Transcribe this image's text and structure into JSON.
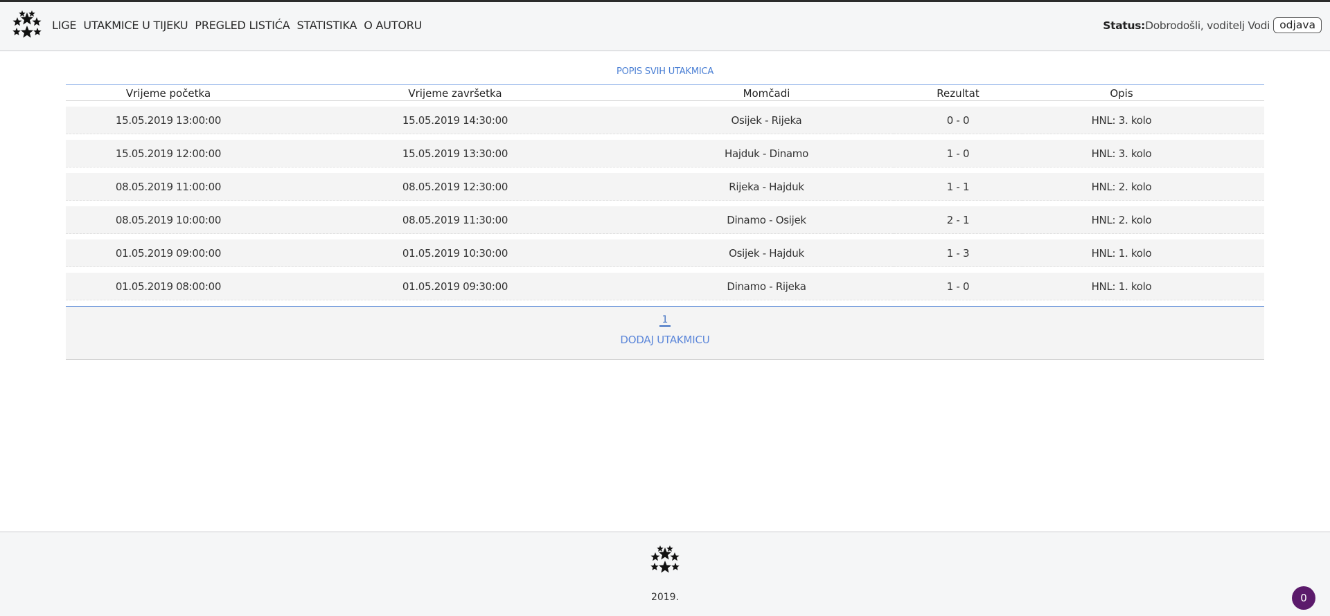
{
  "header": {
    "nav": [
      "LIGE",
      "UTAKMICE U TIJEKU",
      "PREGLED LISTIĆA",
      "STATISTIKA",
      "O AUTORU"
    ],
    "status_label": "Status:",
    "status_text": "Dobrodošli, voditelj Vodi",
    "logout_label": "odjava",
    "logo_icon": "soccer-stars-logo-icon"
  },
  "main": {
    "title": "POPIS SVIH UTAKMICA",
    "columns": [
      "Vrijeme početka",
      "Vrijeme završetka",
      "Momčadi",
      "Rezultat",
      "Opis"
    ],
    "rows": [
      [
        "15.05.2019 13:00:00",
        "15.05.2019 14:30:00",
        "Osijek - Rijeka",
        "0 - 0",
        "HNL: 3. kolo"
      ],
      [
        "15.05.2019 12:00:00",
        "15.05.2019 13:30:00",
        "Hajduk - Dinamo",
        "1 - 0",
        "HNL: 3. kolo"
      ],
      [
        "08.05.2019 11:00:00",
        "08.05.2019 12:30:00",
        "Rijeka - Hajduk",
        "1 - 1",
        "HNL: 2. kolo"
      ],
      [
        "08.05.2019 10:00:00",
        "08.05.2019 11:30:00",
        "Dinamo - Osijek",
        "2 - 1",
        "HNL: 2. kolo"
      ],
      [
        "01.05.2019 09:00:00",
        "01.05.2019 10:30:00",
        "Osijek - Hajduk",
        "1 - 3",
        "HNL: 1. kolo"
      ],
      [
        "01.05.2019 08:00:00",
        "01.05.2019 09:30:00",
        "Dinamo - Rijeka",
        "1 - 0",
        "HNL: 1. kolo"
      ]
    ],
    "page": "1",
    "add_label": "DODAJ UTAKMICU"
  },
  "footer": {
    "year": "2019.",
    "badge_count": "0",
    "logo_icon": "soccer-stars-logo-icon"
  },
  "colors": {
    "accent": "#4a7fd4",
    "badge": "#5b1a6b"
  }
}
